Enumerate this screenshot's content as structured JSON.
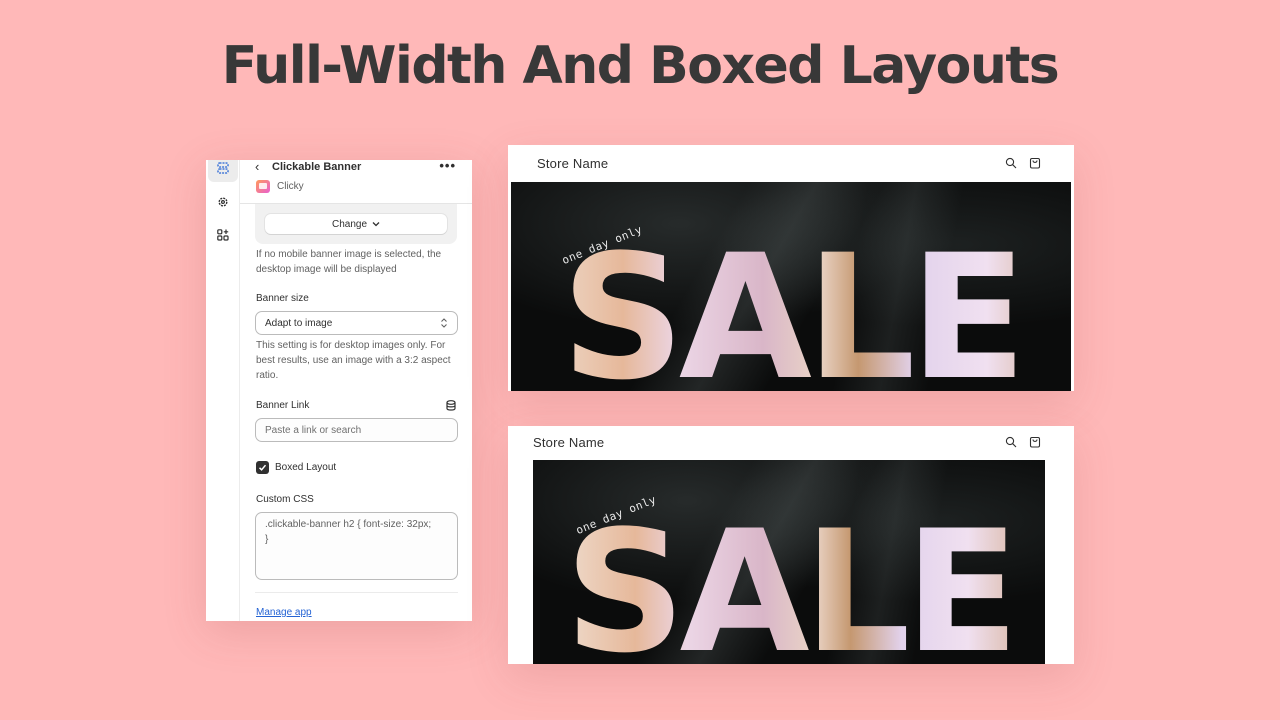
{
  "page": {
    "title": "Full-Width And Boxed Layouts",
    "background_color": "#ffb8b8"
  },
  "panel": {
    "rail": [
      {
        "name": "sections",
        "icon": "sections-icon",
        "active": true
      },
      {
        "name": "settings",
        "icon": "gear-icon",
        "active": false
      },
      {
        "name": "apps",
        "icon": "apps-add-icon",
        "active": false
      }
    ],
    "header": {
      "back_glyph": "‹",
      "title": "Clickable Banner",
      "more_glyph": "•••",
      "app_name": "Clicky"
    },
    "change_button": "Change",
    "mobile_image_help": "If no mobile banner image is selected, the desktop image will be displayed",
    "banner_size": {
      "label": "Banner size",
      "value": "Adapt to image",
      "help": "This setting is for desktop images only. For best results, use an image with a 3:2 aspect ratio."
    },
    "banner_link": {
      "label": "Banner Link",
      "placeholder": "Paste a link or search"
    },
    "boxed_layout": {
      "label": "Boxed Layout",
      "checked": true
    },
    "custom_css": {
      "label": "Custom CSS",
      "value": ".clickable-banner h2 { font-size: 32px;\n}"
    },
    "manage_app_link": "Manage app",
    "link_color": "#2463d4"
  },
  "previews": [
    {
      "layout": "full-width",
      "store_name": "Store Name",
      "banner": {
        "headline": "SALE",
        "tagline": "one day only"
      }
    },
    {
      "layout": "boxed",
      "store_name": "Store Name",
      "banner": {
        "headline": "SALE",
        "tagline": "one day only"
      }
    }
  ]
}
